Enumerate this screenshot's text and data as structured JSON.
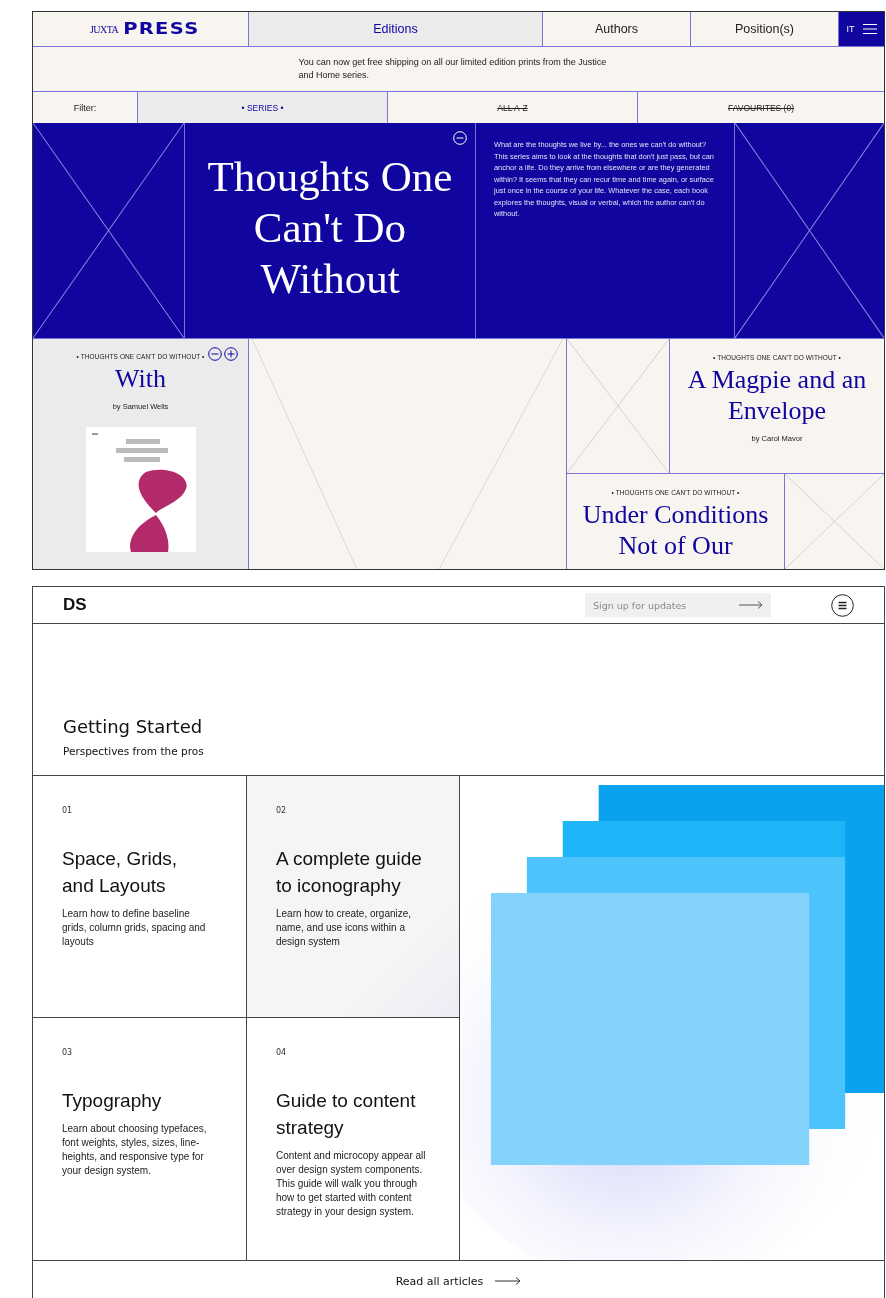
{
  "press": {
    "logo": {
      "prefix": "JUXTA",
      "name": "PRESS"
    },
    "nav": [
      {
        "label": "Editions",
        "selected": true
      },
      {
        "label": "Authors",
        "selected": false
      },
      {
        "label": "Position(s)",
        "selected": false
      }
    ],
    "language": {
      "label": "IT",
      "selected": true
    },
    "notice": "You can now get free shipping on all our limited edition prints from the Justice and Home series.",
    "filter_label": "Filter:",
    "filters": [
      {
        "label": "• SERIES •",
        "selected": true
      },
      {
        "label": "ALL A-Z",
        "selected": false
      },
      {
        "label": "FAVOURITES (0)",
        "selected": false
      }
    ],
    "hero": {
      "title": "Thoughts One Can't Do Without",
      "description": "What are the thoughts we live by... the ones we can't do without? This series aims to look at the thoughts that don't just pass, but can anchor a life. Do they arrive from elsewhere or are they generated within? It seems that they can recur time and time again, or surface just once in the course of your life. Whatever the case, each book explores the thoughts, visual or verbal, which the author can't do without."
    },
    "books": [
      {
        "series": "• THOUGHTS ONE CAN'T DO WITHOUT •",
        "title": "With",
        "author": "by Samuel Wells"
      },
      {
        "series": "• THOUGHTS ONE CAN'T DO WITHOUT •",
        "title": "A Magpie and an Envelope",
        "author": "by Carol Mavor"
      },
      {
        "series": "• THOUGHTS ONE CAN'T DO WITHOUT •",
        "title": "Under Conditions Not of Our"
      }
    ]
  },
  "ds": {
    "logo": "DS",
    "signup": {
      "placeholder": "Sign up for updates"
    },
    "heading": "Getting Started",
    "subheading": "Perspectives from the pros",
    "articles": [
      {
        "number": "01",
        "title": "Space, Grids, and Layouts",
        "description": "Learn how to define baseline grids, column grids, spacing and layouts",
        "highlighted": false
      },
      {
        "number": "02",
        "title": "A complete guide to iconography",
        "description": "Learn how to create, organize, name, and use icons within a design system",
        "highlighted": true
      },
      {
        "number": "03",
        "title": "Typography",
        "description": "Learn about choosing typefaces, font weights, styles, sizes, line-heights, and responsive type for your design system.",
        "highlighted": false
      },
      {
        "number": "04",
        "title": "Guide to content strategy",
        "description": "Content and microcopy appear all over design system components. This guide will walk you through how to get started with content strategy in your design system.",
        "highlighted": false
      }
    ],
    "read_more": "Read all articles"
  }
}
